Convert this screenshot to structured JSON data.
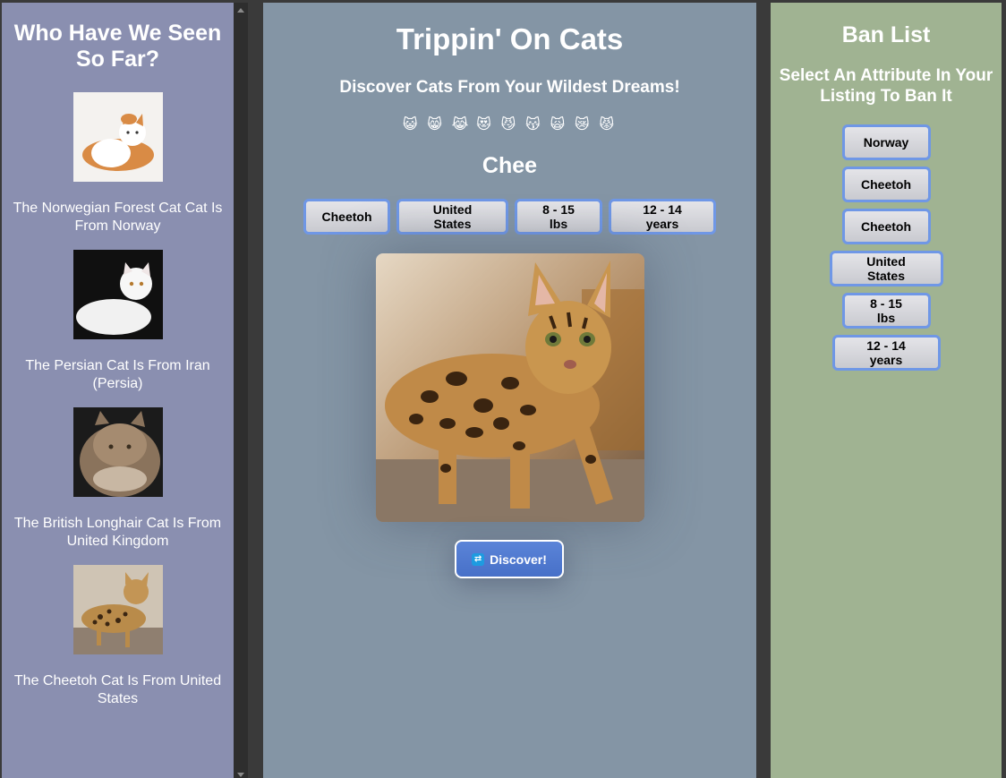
{
  "history": {
    "title": "Who Have We Seen So Far?",
    "items": [
      {
        "caption": "The Norwegian Forest Cat Cat Is From Norway"
      },
      {
        "caption": "The Persian Cat Is From Iran (Persia)"
      },
      {
        "caption": "The British Longhair Cat Is From United Kingdom"
      },
      {
        "caption": "The Cheetoh Cat Is From United States"
      }
    ]
  },
  "main": {
    "title": "Trippin' On Cats",
    "subtitle": "Discover Cats From Your Wildest Dreams!",
    "emojis": [
      "😺",
      "😸",
      "😹",
      "😻",
      "😼",
      "😽",
      "🙀",
      "😿",
      "😾"
    ],
    "cat_name": "Chee",
    "attributes": [
      "Cheetoh",
      "United States",
      "8 - 15 lbs",
      "12 - 14 years"
    ],
    "discover_label": "Discover!"
  },
  "ban": {
    "title": "Ban List",
    "hint": "Select An Attribute In Your Listing To Ban It",
    "items": [
      "Norway",
      "Cheetoh",
      "Cheetoh",
      "United States",
      "8 - 15 lbs",
      "12 - 14 years"
    ]
  }
}
